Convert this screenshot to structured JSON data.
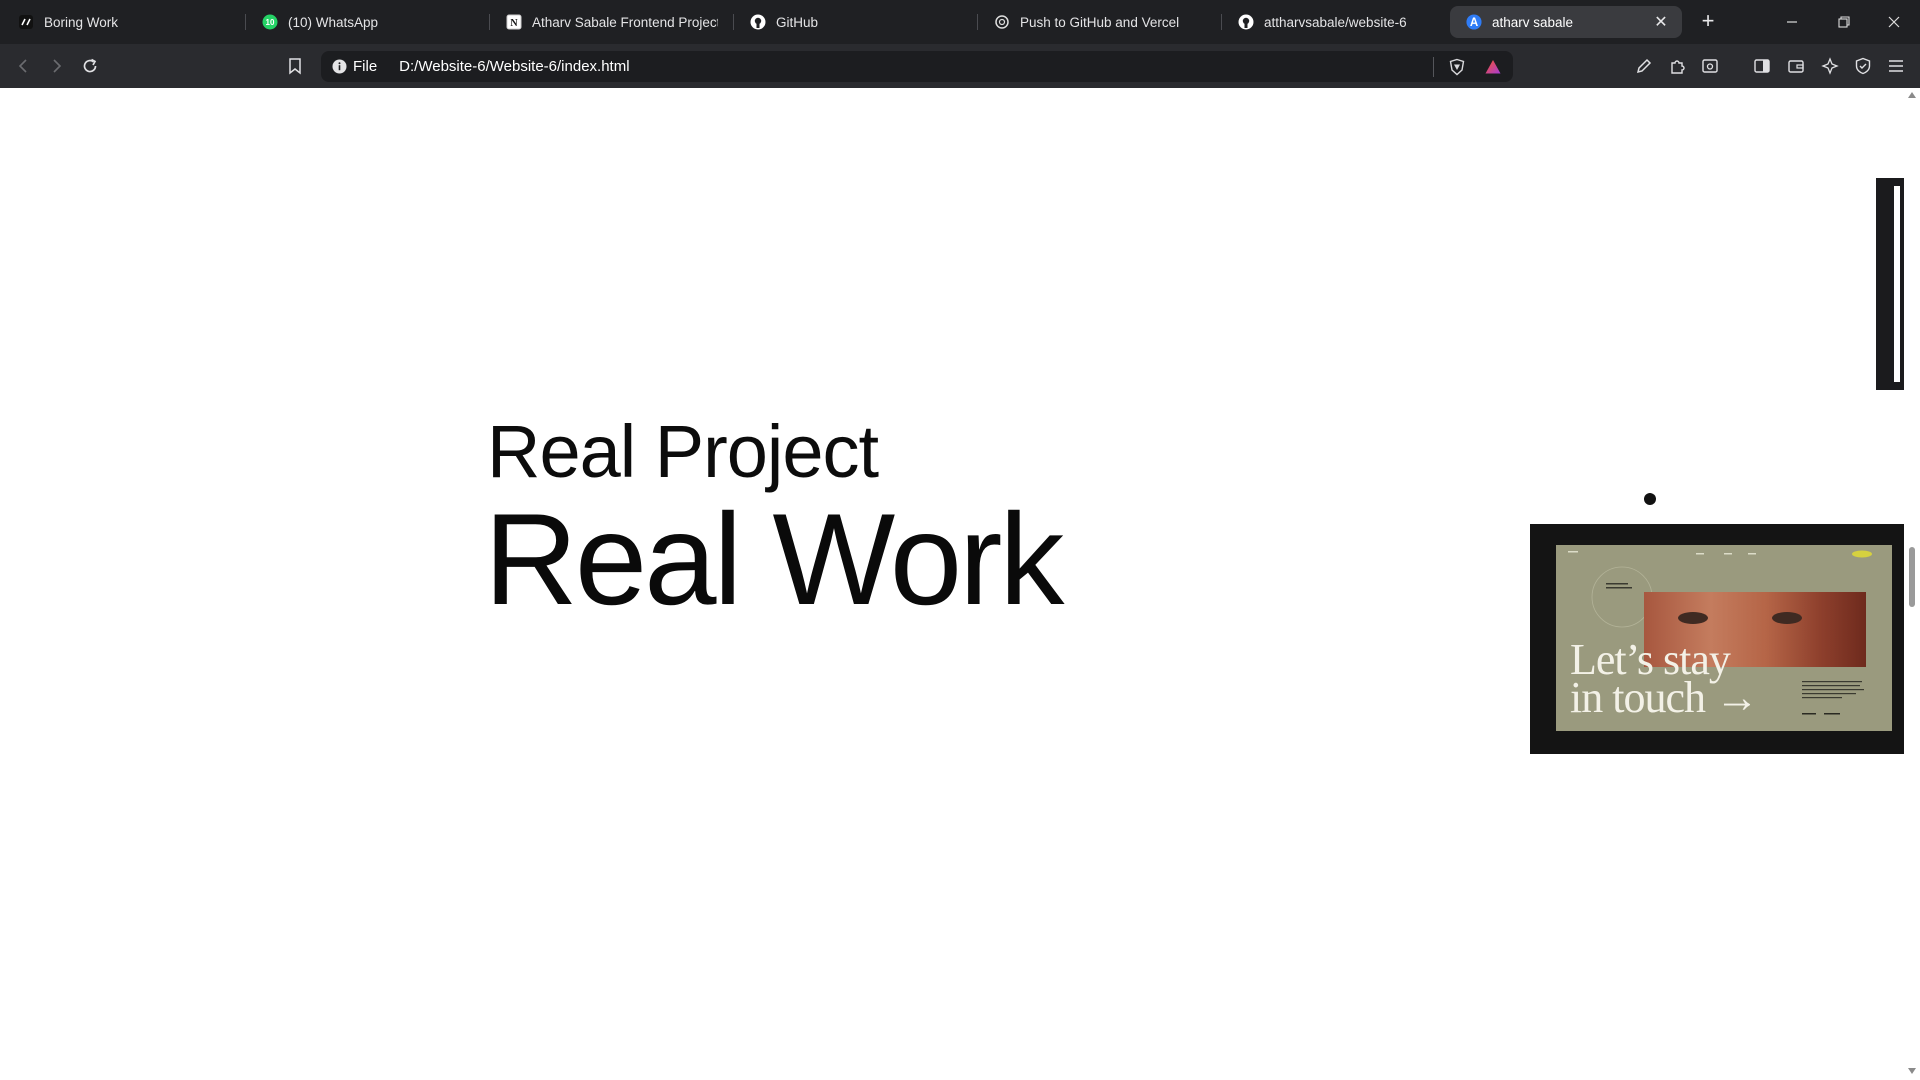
{
  "tabs": [
    {
      "title": "Boring Work",
      "icon": "boring-work-icon"
    },
    {
      "title": "(10) WhatsApp",
      "badge": "10",
      "icon": "whatsapp-icon"
    },
    {
      "title": "Atharv Sabale Frontend Projects",
      "icon": "notion-icon"
    },
    {
      "title": "GitHub",
      "icon": "github-icon"
    },
    {
      "title": "Push to GitHub and Vercel",
      "icon": "chatgpt-icon"
    },
    {
      "title": "attharvsabale/website-6",
      "icon": "github-icon"
    },
    {
      "title": "atharv sabale",
      "icon": "site-a-icon",
      "active": true
    }
  ],
  "omnibox": {
    "scheme": "File",
    "url": "D:/Website-6/Website-6/index.html"
  },
  "hero": {
    "line1": "Real Project",
    "line2": "Real Work"
  },
  "preview": {
    "headline_1": "Let’s stay",
    "headline_2": "in touch",
    "arrow": "→"
  },
  "colors": {
    "tabstrip": "#1f2023",
    "toolbar": "#2a2b2f",
    "page_bg": "#ffffff",
    "preview_bg": "#9a9a7e",
    "brave_orange": "#fb542b"
  }
}
